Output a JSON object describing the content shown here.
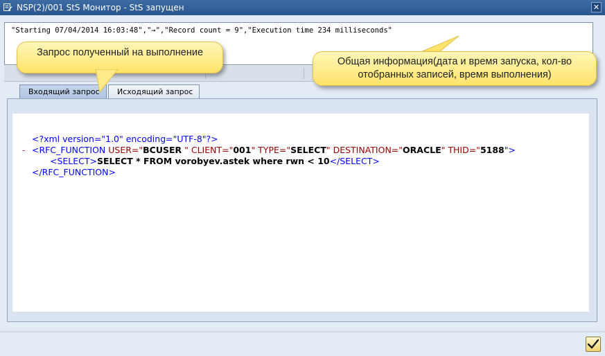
{
  "window": {
    "title": "NSP(2)/001 StS Монитор - StS запущен",
    "close_glyph": "✕"
  },
  "status": {
    "line": "\"Starting 07/04/2014 16:03:48\",\"→\",\"Record count = 9\",\"Execution time 234 milliseconds\""
  },
  "tabs": {
    "incoming": "Входящий запрос",
    "outgoing": "Исходящий запрос",
    "active": "incoming"
  },
  "xml": {
    "decl": "<?xml version=\"1.0\" encoding=\"UTF-8\"?>",
    "collapse_marker": "-",
    "rfc_open_tag": "<RFC_FUNCTION",
    "attr_user_name": " USER=\"",
    "attr_user_value": "BCUSER",
    "attr_client_name": " \" CLIENT=\"",
    "attr_client_value": "001",
    "attr_type_name": "\" TYPE=\"",
    "attr_type_value": "SELECT",
    "attr_dest_name": "\" DESTINATION=\"",
    "attr_dest_value": "ORACLE",
    "attr_thid_name": "\" THID=\"",
    "attr_thid_value": "5188",
    "attr_close": "\">",
    "select_open": "<SELECT>",
    "select_text": "SELECT * FROM vorobyev.astek where rwn < 10",
    "select_close": "</SELECT>",
    "rfc_close": "</RFC_FUNCTION>"
  },
  "callouts": {
    "request": "Запрос полученный на выполнение",
    "general_info": "Общая информация(дата и время запуска, кол-во отобранных записей, время выполнения)"
  },
  "icons": {
    "app": "window-menu-icon",
    "ok": "checkmark-icon"
  },
  "colors": {
    "titlebar": "#2a568f",
    "callout": "#ffe36a",
    "xml_markup": "#0000ff",
    "xml_attr": "#990000"
  }
}
